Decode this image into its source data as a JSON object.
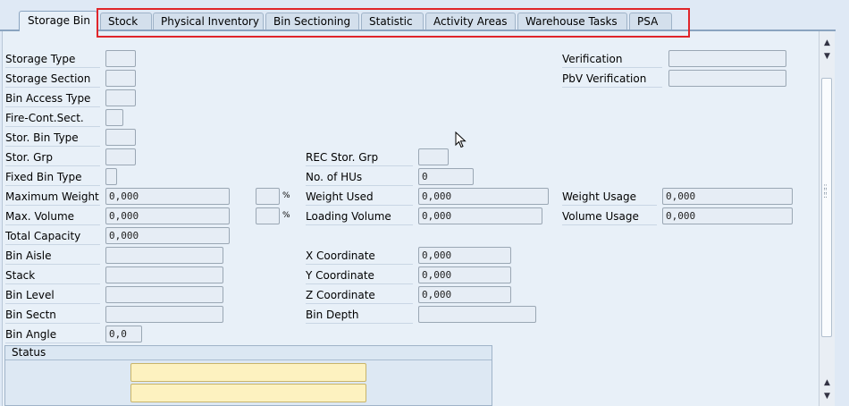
{
  "tabs": [
    {
      "label": "Storage Bin",
      "active": true
    },
    {
      "label": "Stock"
    },
    {
      "label": "Physical Inventory"
    },
    {
      "label": "Bin Sectioning"
    },
    {
      "label": "Statistic"
    },
    {
      "label": "Activity Areas"
    },
    {
      "label": "Warehouse Tasks"
    },
    {
      "label": "PSA"
    }
  ],
  "left": {
    "storage_type": {
      "label": "Storage Type",
      "value": ""
    },
    "storage_section": {
      "label": "Storage Section",
      "value": ""
    },
    "bin_access_type": {
      "label": "Bin Access Type",
      "value": ""
    },
    "fire_cont_sect": {
      "label": "Fire-Cont.Sect.",
      "value": ""
    },
    "stor_bin_type": {
      "label": "Stor. Bin Type",
      "value": ""
    },
    "stor_grp": {
      "label": "Stor. Grp",
      "value": ""
    },
    "fixed_bin_type": {
      "label": "Fixed Bin Type",
      "value": ""
    },
    "maximum_weight": {
      "label": "Maximum Weight",
      "value": "0,000",
      "pct_value": "",
      "pct_unit": "%"
    },
    "max_volume": {
      "label": "Max. Volume",
      "value": "0,000",
      "pct_value": "",
      "pct_unit": "%"
    },
    "total_capacity": {
      "label": "Total Capacity",
      "value": "0,000"
    },
    "bin_aisle": {
      "label": "Bin Aisle",
      "value": ""
    },
    "stack": {
      "label": "Stack",
      "value": ""
    },
    "bin_level": {
      "label": "Bin Level",
      "value": ""
    },
    "bin_sectn": {
      "label": "Bin Sectn",
      "value": ""
    },
    "bin_angle": {
      "label": "Bin Angle",
      "value": "0,0"
    }
  },
  "middle": {
    "rec_stor_grp": {
      "label": "REC Stor. Grp",
      "value": ""
    },
    "no_of_hus": {
      "label": "No. of HUs",
      "value": "0"
    },
    "weight_used": {
      "label": "Weight Used",
      "value": "0,000"
    },
    "loading_volume": {
      "label": "Loading Volume",
      "value": "0,000"
    },
    "x_coordinate": {
      "label": "X Coordinate",
      "value": "0,000"
    },
    "y_coordinate": {
      "label": "Y Coordinate",
      "value": "0,000"
    },
    "z_coordinate": {
      "label": "Z Coordinate",
      "value": "0,000"
    },
    "bin_depth": {
      "label": "Bin Depth",
      "value": ""
    }
  },
  "right": {
    "verification": {
      "label": "Verification",
      "value": ""
    },
    "pbv_verification": {
      "label": "PbV Verification",
      "value": ""
    },
    "weight_usage": {
      "label": "Weight Usage",
      "value": "0,000"
    },
    "volume_usage": {
      "label": "Volume Usage",
      "value": "0,000"
    }
  },
  "status": {
    "title": "Status",
    "field1": "",
    "field2": ""
  },
  "colors": {
    "background": "#dfe9f5",
    "panel": "#e8f0f8",
    "highlight_box": "#e0262b",
    "status_field": "#fdf2c0"
  },
  "icons": [
    "scroll-up-icon",
    "scroll-down-icon",
    "scroll-bottom-up-icon",
    "scroll-bottom-down-icon",
    "mouse-cursor-icon"
  ]
}
